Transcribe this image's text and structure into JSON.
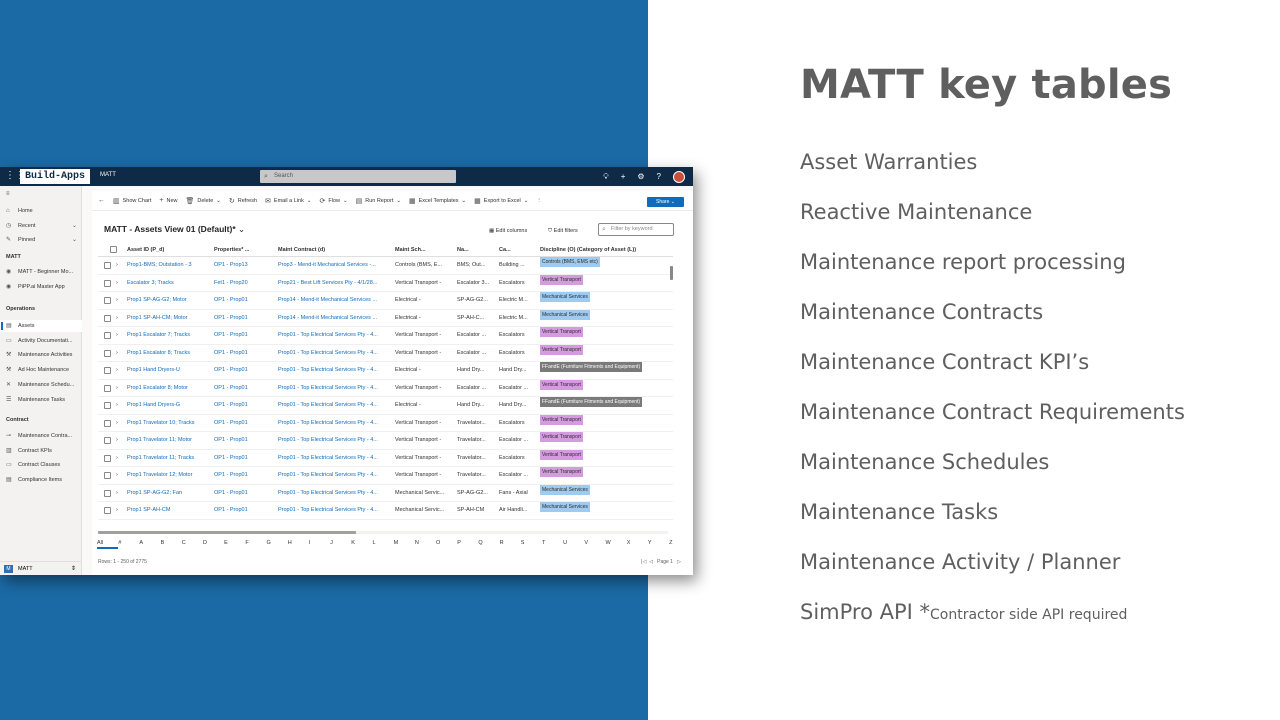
{
  "slide": {
    "title": "MATT key tables",
    "topics": [
      {
        "label": "Asset Warranties"
      },
      {
        "label": "Reactive Maintenance"
      },
      {
        "label": "Maintenance report processing"
      },
      {
        "label": "Maintenance Contracts"
      },
      {
        "label": "Maintenance Contract KPI’s"
      },
      {
        "label": "Maintenance Contract Requirements"
      },
      {
        "label": "Maintenance Schedules"
      },
      {
        "label": "Maintenance Tasks"
      },
      {
        "label": "Maintenance Activity / Planner"
      },
      {
        "label": "SimPro API *",
        "note": "Contractor side API required"
      }
    ]
  },
  "app": {
    "brand": "Build-Apps",
    "app_name": "MATT",
    "search_placeholder": "Search",
    "header_icons": [
      "lightbulb-icon",
      "plus-icon",
      "gear-icon",
      "help-icon"
    ],
    "sidebar": {
      "items_top": [
        {
          "label": "Home",
          "icon": "home-icon"
        },
        {
          "label": "Recent",
          "icon": "clock-icon"
        },
        {
          "label": "Pinned",
          "icon": "pin-icon"
        }
      ],
      "section_matt": "MATT",
      "items_matt": [
        {
          "label": "MATT - Beginner Mo...",
          "icon": "app-icon"
        },
        {
          "label": "PiPP.ai Master App",
          "icon": "app-icon"
        }
      ],
      "section_operations": "Operations",
      "items_operations": [
        {
          "label": "Assets",
          "icon": "list-icon"
        },
        {
          "label": "Activity Documentati...",
          "icon": "doc-icon"
        },
        {
          "label": "Maintenance Activities",
          "icon": "wrench-icon"
        },
        {
          "label": "Ad Hoc Maintenance",
          "icon": "wrench-icon"
        },
        {
          "label": "Maintenance Schedu...",
          "icon": "tools-icon"
        },
        {
          "label": "Maintenance Tasks",
          "icon": "task-icon"
        }
      ],
      "section_contract": "Contract",
      "items_contract": [
        {
          "label": "Maintenance Contra...",
          "icon": "contract-icon"
        },
        {
          "label": "Contract KPIs",
          "icon": "chart-icon"
        },
        {
          "label": "Contract Clauses",
          "icon": "doc-icon"
        },
        {
          "label": "Compliance Items",
          "icon": "list-icon"
        }
      ],
      "area_badge": "M",
      "area_label": "MATT"
    },
    "commands": [
      "Show Chart",
      "New",
      "Delete",
      "Refresh",
      "Email a Link",
      "Flow",
      "Run Report",
      "Excel Templates",
      "Export to Excel"
    ],
    "share_label": "Share",
    "view_title": "MATT - Assets View 01 (Default)*",
    "edit_columns": "Edit columns",
    "edit_filters": "Edit filters",
    "filter_placeholder": "Filter by keyword",
    "columns": [
      "Asset ID (P_d)",
      "Properties* ...",
      "Maint Contract (d)",
      "Maint Sch...",
      "Na...",
      "Ca...",
      "Discipline (O) (Category of Asset (L))"
    ],
    "rows": [
      {
        "asset": "Prop1-BMS; Outstation - 3",
        "prop": "OP1 - Prop13",
        "contract": "Prop3 - Mend-it Mechanical Services -...",
        "sch": "Controls (BMS, E...",
        "na": "BMS; Out...",
        "ca": "Building ...",
        "disc": "Controls (BMS, EMS etc)",
        "disc_color": "#9fcbf0"
      },
      {
        "asset": "Escalator 3; Tracks",
        "prop": "Fet1 - Prop20",
        "contract": "Prop21 - Best Lift Services Pty - 4/1/28...",
        "sch": "Vertical Transport -",
        "na": "Escalator 3...",
        "ca": "Escalators",
        "disc": "Vertical Transport",
        "disc_color": "#d59ae0"
      },
      {
        "asset": "Prop1 SP-AG-G2; Motor",
        "prop": "OP1 - Prop01",
        "contract": "Prop14 - Mend-it Mechanical Services ...",
        "sch": "Electrical -",
        "na": "SP-AG-G2...",
        "ca": "Electric M...",
        "disc": "Mechanical Services",
        "disc_color": "#9fcbf0"
      },
      {
        "asset": "Prop1 SP-AH-CM; Motor",
        "prop": "OP1 - Prop01",
        "contract": "Prop14 - Mend-it Mechanical Services ...",
        "sch": "Electrical -",
        "na": "SP-AH-C...",
        "ca": "Electric M...",
        "disc": "Mechanical Services",
        "disc_color": "#9fcbf0"
      },
      {
        "asset": "Prop1 Escalator 7; Tracks",
        "prop": "OP1 - Prop01",
        "contract": "Prop01 - Top Electrical Services Pty - 4...",
        "sch": "Vertical Transport -",
        "na": "Escalator ...",
        "ca": "Escalators",
        "disc": "Vertical Transport",
        "disc_color": "#d59ae0"
      },
      {
        "asset": "Prop1 Escalator 8; Tracks",
        "prop": "OP1 - Prop01",
        "contract": "Prop01 - Top Electrical Services Pty - 4...",
        "sch": "Vertical Transport -",
        "na": "Escalator ...",
        "ca": "Escalators",
        "disc": "Vertical Transport",
        "disc_color": "#d59ae0"
      },
      {
        "asset": "Prop1 Hand Dryers-U",
        "prop": "OP1 - Prop01",
        "contract": "Prop01 - Top Electrical Services Pty - 4...",
        "sch": "Electrical -",
        "na": "Hand Dry...",
        "ca": "Hand Dry...",
        "disc": "FFandE (Furniture Fitments and Equipment)",
        "disc_color": "#7a7a7a"
      },
      {
        "asset": "Prop1 Escalator 8; Motor",
        "prop": "OP1 - Prop01",
        "contract": "Prop01 - Top Electrical Services Pty - 4...",
        "sch": "Vertical Transport -",
        "na": "Escalator ...",
        "ca": "Escalator ...",
        "disc": "Vertical Transport",
        "disc_color": "#d59ae0"
      },
      {
        "asset": "Prop1 Hand Dryers-G",
        "prop": "OP1 - Prop01",
        "contract": "Prop01 - Top Electrical Services Pty - 4...",
        "sch": "Electrical -",
        "na": "Hand Dry...",
        "ca": "Hand Dry...",
        "disc": "FFandE (Furniture Fitments and Equipment)",
        "disc_color": "#7a7a7a"
      },
      {
        "asset": "Prop1 Travelator 10; Tracks",
        "prop": "OP1 - Prop01",
        "contract": "Prop01 - Top Electrical Services Pty - 4...",
        "sch": "Vertical Transport -",
        "na": "Travelator...",
        "ca": "Escalators",
        "disc": "Vertical Transport",
        "disc_color": "#d59ae0"
      },
      {
        "asset": "Prop1 Travelator 11; Motor",
        "prop": "OP1 - Prop01",
        "contract": "Prop01 - Top Electrical Services Pty - 4...",
        "sch": "Vertical Transport -",
        "na": "Travelator...",
        "ca": "Escalator ...",
        "disc": "Vertical Transport",
        "disc_color": "#d59ae0"
      },
      {
        "asset": "Prop1 Travelator 11; Tracks",
        "prop": "OP1 - Prop01",
        "contract": "Prop01 - Top Electrical Services Pty - 4...",
        "sch": "Vertical Transport -",
        "na": "Travelator...",
        "ca": "Escalators",
        "disc": "Vertical Transport",
        "disc_color": "#d59ae0"
      },
      {
        "asset": "Prop1 Travelator 12; Motor",
        "prop": "OP1 - Prop01",
        "contract": "Prop01 - Top Electrical Services Pty - 4...",
        "sch": "Vertical Transport -",
        "na": "Travelator...",
        "ca": "Escalator ...",
        "disc": "Vertical Transport",
        "disc_color": "#d59ae0"
      },
      {
        "asset": "Prop1 SP-AG-G2; Fan",
        "prop": "OP1 - Prop01",
        "contract": "Prop01 - Top Electrical Services Pty - 4...",
        "sch": "Mechanical Servic...",
        "na": "SP-AG-G2...",
        "ca": "Fans - Axial",
        "disc": "Mechanical Services",
        "disc_color": "#9fcbf0"
      },
      {
        "asset": "Prop1 SP-AH-CM",
        "prop": "OP1 - Prop01",
        "contract": "Prop01 - Top Electrical Services Pty - 4...",
        "sch": "Mechanical Servic...",
        "na": "SP-AH-CM",
        "ca": "Air Handli...",
        "disc": "Mechanical Services",
        "disc_color": "#9fcbf0"
      }
    ],
    "alphabet": [
      "All",
      "#",
      "A",
      "B",
      "C",
      "D",
      "E",
      "F",
      "G",
      "H",
      "I",
      "J",
      "K",
      "L",
      "M",
      "N",
      "O",
      "P",
      "Q",
      "R",
      "S",
      "T",
      "U",
      "V",
      "W",
      "X",
      "Y",
      "Z"
    ],
    "rows_count": "Rows: 1 - 250 of 2775",
    "page_label": "Page 1",
    "colors": {
      "slide_blue": "#1b6aa5",
      "header_navy": "#0f2a47",
      "accent": "#0f6cbd"
    }
  }
}
